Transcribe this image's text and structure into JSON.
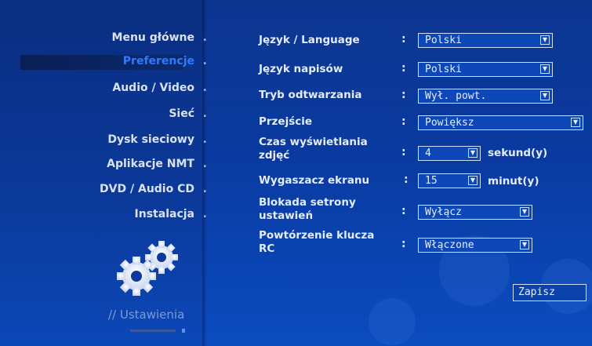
{
  "sidebar": {
    "items": [
      {
        "label": "Menu główne"
      },
      {
        "label": "Preferencje",
        "active": true
      },
      {
        "label": "Audio / Video"
      },
      {
        "label": "Sieć"
      },
      {
        "label": "Dysk sieciowy"
      },
      {
        "label": "Aplikacje NMT"
      },
      {
        "label": "DVD / Audio CD"
      },
      {
        "label": "Instalacja"
      }
    ],
    "dot": "."
  },
  "section_title": "// Ustawienia",
  "settings": [
    {
      "label": "Język / Language",
      "value": "Polski"
    },
    {
      "label": "Język napisów",
      "value": "Polski"
    },
    {
      "label": "Tryb odtwarzania",
      "value": "Wył. powt."
    },
    {
      "label": "Przejście",
      "value": "Powiększ"
    },
    {
      "label_line1": "Czas wyświetlania",
      "label_line2": "zdjęć",
      "value": "4",
      "unit": "sekund(y)"
    },
    {
      "label": "Wygaszacz ekranu",
      "value": "15",
      "unit": "minut(y)"
    },
    {
      "label_line1": "Blokada setrony",
      "label_line2": "ustawień",
      "value": "Wyłącz"
    },
    {
      "label_line1": "Powtórzenie klucza",
      "label_line2": "RC",
      "value": "Włączone"
    }
  ],
  "colon": ":",
  "save_label": "Zapisz",
  "colors": {
    "background": "#0b3aa0",
    "active_menu": "#2d7bff",
    "text": "#e4ecff"
  }
}
